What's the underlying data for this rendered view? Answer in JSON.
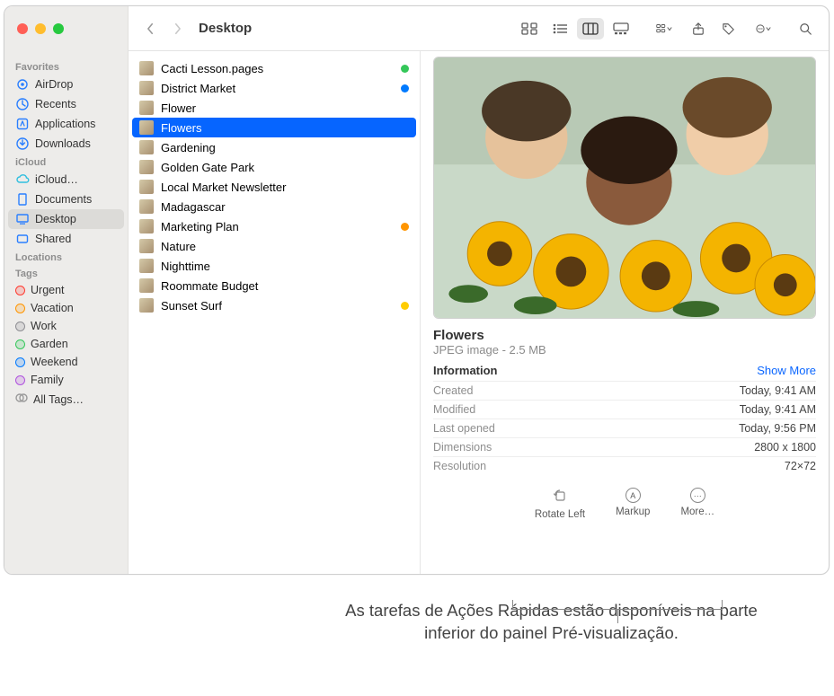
{
  "window": {
    "title": "Desktop"
  },
  "sidebar": {
    "sections": [
      {
        "title": "Favorites",
        "items": [
          {
            "icon": "airdrop",
            "label": "AirDrop"
          },
          {
            "icon": "clock",
            "label": "Recents"
          },
          {
            "icon": "app",
            "label": "Applications"
          },
          {
            "icon": "download",
            "label": "Downloads"
          }
        ]
      },
      {
        "title": "iCloud",
        "items": [
          {
            "icon": "cloud",
            "label": "iCloud…"
          },
          {
            "icon": "doc",
            "label": "Documents"
          },
          {
            "icon": "desktop",
            "label": "Desktop",
            "active": true
          },
          {
            "icon": "shared",
            "label": "Shared"
          }
        ]
      },
      {
        "title": "Locations",
        "items": []
      },
      {
        "title": "Tags",
        "items": [
          {
            "tagcolor": "#ff3b30",
            "label": "Urgent"
          },
          {
            "tagcolor": "#ff9500",
            "label": "Vacation"
          },
          {
            "tagcolor": "#8e8e93",
            "label": "Work"
          },
          {
            "tagcolor": "#34c759",
            "label": "Garden"
          },
          {
            "tagcolor": "#007aff",
            "label": "Weekend"
          },
          {
            "tagcolor": "#af52de",
            "label": "Family"
          },
          {
            "tagcolor": "multi",
            "label": "All Tags…"
          }
        ]
      }
    ]
  },
  "files": [
    {
      "name": "Cacti Lesson.pages",
      "tag": "#34c759"
    },
    {
      "name": "District Market",
      "tag": "#007aff"
    },
    {
      "name": "Flower"
    },
    {
      "name": "Flowers",
      "selected": true
    },
    {
      "name": "Gardening"
    },
    {
      "name": "Golden Gate Park"
    },
    {
      "name": "Local Market Newsletter"
    },
    {
      "name": "Madagascar"
    },
    {
      "name": "Marketing Plan",
      "tag": "#ff9500"
    },
    {
      "name": "Nature"
    },
    {
      "name": "Nighttime"
    },
    {
      "name": "Roommate Budget"
    },
    {
      "name": "Sunset Surf",
      "tag": "#ffcc00"
    }
  ],
  "preview": {
    "name": "Flowers",
    "kind": "JPEG image - 2.5 MB",
    "section_title": "Information",
    "show_more": "Show More",
    "info": [
      {
        "k": "Created",
        "v": "Today, 9:41 AM"
      },
      {
        "k": "Modified",
        "v": "Today, 9:41 AM"
      },
      {
        "k": "Last opened",
        "v": "Today, 9:56 PM"
      },
      {
        "k": "Dimensions",
        "v": "2800 x 1800"
      },
      {
        "k": "Resolution",
        "v": "72×72"
      }
    ],
    "quick_actions": [
      {
        "label": "Rotate Left",
        "icon": "rotate"
      },
      {
        "label": "Markup",
        "icon": "markup"
      },
      {
        "label": "More…",
        "icon": "more"
      }
    ]
  },
  "caption": "As tarefas de Ações Rápidas estão disponíveis na parte inferior do painel Pré-visualização."
}
